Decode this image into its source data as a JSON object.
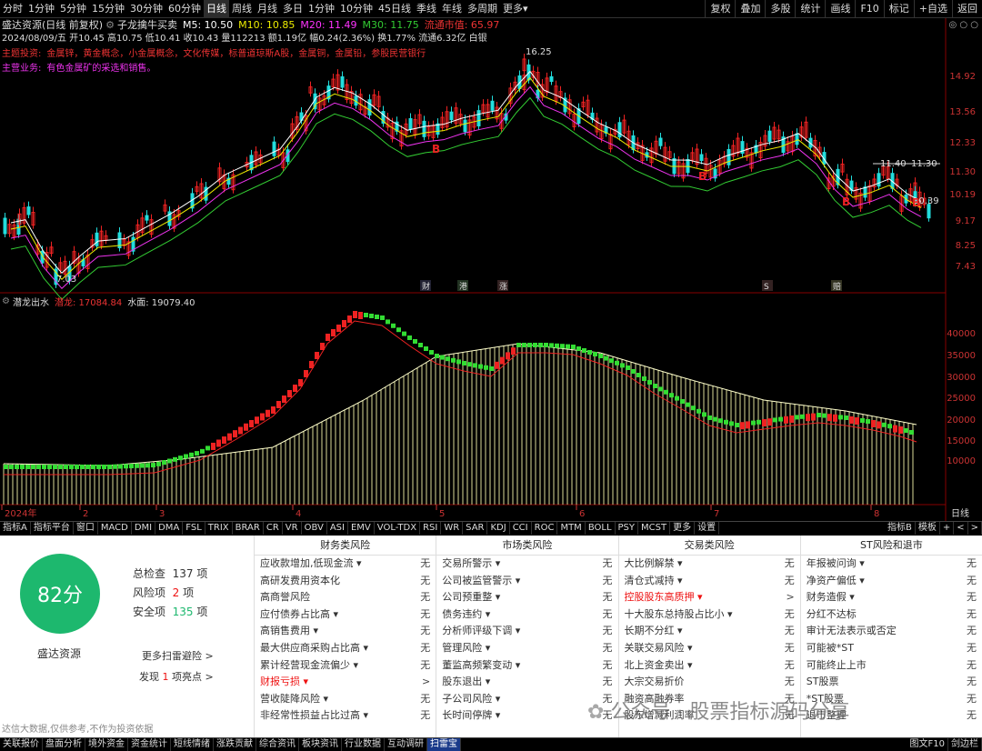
{
  "topbar": {
    "periods": [
      "分时",
      "1分钟",
      "5分钟",
      "15分钟",
      "30分钟",
      "60分钟",
      "日线",
      "周线",
      "月线",
      "多日",
      "1分钟",
      "10分钟",
      "45日线",
      "季线",
      "年线",
      "多周期",
      "更多▾"
    ],
    "buttons": [
      "复权",
      "叠加",
      "多股",
      "统计",
      "画线",
      "F10",
      "标记",
      "+自选",
      "返回"
    ]
  },
  "header": {
    "stock_title": "盛达资源(日线 前复权)",
    "indicator": "子龙擒牛买卖",
    "ma5": "M5: 10.50",
    "ma10": "M10: 10.85",
    "ma20": "M20: 11.49",
    "ma30": "M30: 11.75",
    "float_cap": "流通市值: 65.97",
    "ohlc_line": "2024/08/09/五 开10.45 高10.75 低10.41 收10.43 量112213 额1.19亿 幅0.24(2.36%) 换1.77% 流通6.32亿 白银",
    "theme_label": "主题投资:",
    "theme_value": "金属锌，黄金概念，小金属概念，文化传媒，标普道琼斯A股，金属铜，金属铅，参股民营银行",
    "business_label": "主营业务:",
    "business_value": "有色金属矿的采选和销售。"
  },
  "chart_data": [
    {
      "type": "candlestick",
      "title": "盛达资源(日线 前复权)",
      "y_ticks": [
        "14.92",
        "13.56",
        "12.33",
        "11.30",
        "10.19",
        "9.17",
        "8.25",
        "7.43"
      ],
      "annotations": [
        "16.25",
        "11.40",
        "11.30",
        "10.39",
        "7.03"
      ],
      "markers": [
        "B",
        "B",
        "B",
        "B"
      ],
      "event_tags": [
        "财",
        "港",
        "涨",
        "S",
        "赔"
      ]
    },
    {
      "type": "area",
      "title": "潜龙出水",
      "series_label": "潜龙: 17084.84",
      "water_label": "水面: 19079.40",
      "y_ticks": [
        "40000",
        "35000",
        "30000",
        "25000",
        "20000",
        "15000",
        "10000"
      ],
      "x_ticks": [
        "2024年",
        "2",
        "3",
        "4",
        "5",
        "6",
        "7",
        "8"
      ],
      "axis_label": "日线"
    }
  ],
  "indicator_tabs": [
    "指标A",
    "指标平台",
    "窗口",
    "MACD",
    "DMI",
    "DMA",
    "FSL",
    "TRIX",
    "BRAR",
    "CR",
    "VR",
    "OBV",
    "ASI",
    "EMV",
    "VOL-TDX",
    "RSI",
    "WR",
    "SAR",
    "KDJ",
    "CCI",
    "ROC",
    "MTM",
    "BOLL",
    "PSY",
    "MCST",
    "更多",
    "设置",
    "指标B",
    "模板",
    "+",
    "<",
    ">"
  ],
  "risk": {
    "score": "82分",
    "check_label": "总检查",
    "check_value": "137",
    "risk_label": "风险项",
    "risk_value": "2",
    "safe_label": "安全项",
    "safe_value": "135",
    "unit": "项",
    "company": "盛达资源",
    "more_link": "更多扫雷避险 >",
    "highlight_prefix": "发现",
    "highlight_value": "1",
    "highlight_suffix": "项亮点 >",
    "footnote": "达信大数据,仅供参考,不作为投资依据",
    "columns": [
      {
        "title": "财务类风险",
        "items": [
          {
            "n": "应收款增加,低现金流 ▾",
            "v": "无"
          },
          {
            "n": "高研发费用资本化",
            "v": "无"
          },
          {
            "n": "高商誉风险",
            "v": "无"
          },
          {
            "n": "应付债券占比高 ▾",
            "v": "无"
          },
          {
            "n": "高销售费用 ▾",
            "v": "无"
          },
          {
            "n": "最大供应商采购占比高 ▾",
            "v": "无"
          },
          {
            "n": "累计经营现金流偏少 ▾",
            "v": "无"
          },
          {
            "n": "财报亏损 ▾",
            "v": ">",
            "red": true
          },
          {
            "n": "营收陡降风险 ▾",
            "v": "无"
          },
          {
            "n": "非经常性损益占比过高 ▾",
            "v": "无"
          }
        ]
      },
      {
        "title": "市场类风险",
        "items": [
          {
            "n": "交易所警示 ▾",
            "v": "无"
          },
          {
            "n": "公司被监管警示 ▾",
            "v": "无"
          },
          {
            "n": "公司预重整 ▾",
            "v": "无"
          },
          {
            "n": "债务违约 ▾",
            "v": "无"
          },
          {
            "n": "分析师评级下调 ▾",
            "v": "无"
          },
          {
            "n": "管理风险 ▾",
            "v": "无"
          },
          {
            "n": "董监高频繁变动 ▾",
            "v": "无"
          },
          {
            "n": "股东退出 ▾",
            "v": "无"
          },
          {
            "n": "子公司风险 ▾",
            "v": "无"
          },
          {
            "n": "长时间停牌 ▾",
            "v": "无"
          }
        ]
      },
      {
        "title": "交易类风险",
        "items": [
          {
            "n": "大比例解禁 ▾",
            "v": "无"
          },
          {
            "n": "清仓式减持 ▾",
            "v": "无"
          },
          {
            "n": "控股股东高质押 ▾",
            "v": ">",
            "red": true
          },
          {
            "n": "十大股东总持股占比小 ▾",
            "v": "无"
          },
          {
            "n": "长期不分红 ▾",
            "v": "无"
          },
          {
            "n": "关联交易风险 ▾",
            "v": "无"
          },
          {
            "n": "北上资金卖出 ▾",
            "v": "无"
          },
          {
            "n": "大宗交易折价",
            "v": "无"
          },
          {
            "n": "融资高融券率",
            "v": "无"
          },
          {
            "n": "股东增减利润率",
            "v": "无"
          }
        ]
      },
      {
        "title": "ST风险和退市",
        "items": [
          {
            "n": "年报被问询 ▾",
            "v": "无"
          },
          {
            "n": "净资产偏低 ▾",
            "v": "无"
          },
          {
            "n": "财务造假 ▾",
            "v": "无"
          },
          {
            "n": "分红不达标",
            "v": "无"
          },
          {
            "n": "审计无法表示或否定",
            "v": "无"
          },
          {
            "n": "可能被*ST",
            "v": "无"
          },
          {
            "n": "可能终止上市",
            "v": "无"
          },
          {
            "n": "ST股票",
            "v": "无"
          },
          {
            "n": "*ST股票",
            "v": "无"
          },
          {
            "n": "退市整理",
            "v": "无"
          }
        ]
      }
    ]
  },
  "watermark": "公众号 · 股票指标源码分享",
  "bottombar": [
    "关联报价",
    "盘面分析",
    "境外资金",
    "资金统计",
    "短线情绪",
    "涨跌贡献",
    "综合资讯",
    "板块资讯",
    "行业数据",
    "互动调研",
    "扫雷宝"
  ],
  "bottombar_right": [
    "图文F10",
    "剑边栏"
  ]
}
